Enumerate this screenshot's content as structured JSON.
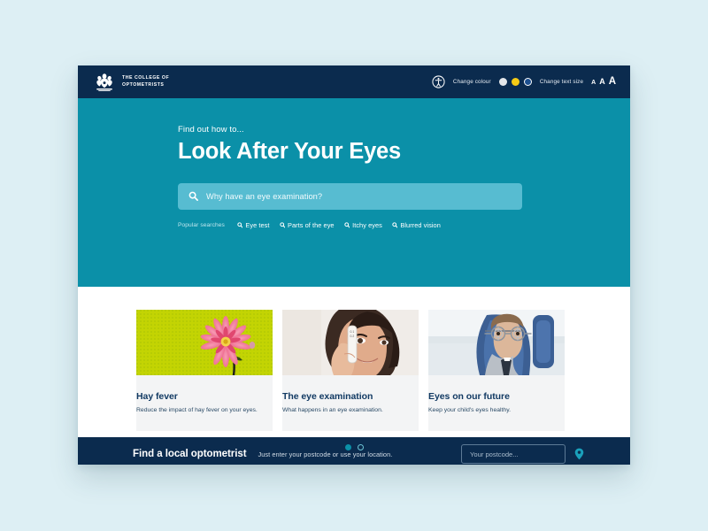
{
  "colors": {
    "page_bg": "#ddeff4",
    "navy": "#0b2b4e",
    "teal": "#0b90a8",
    "teal_light": "#57bcd1",
    "card_bg": "#f3f4f5",
    "heading": "#123a63",
    "swatch_white": "#e3e7ea",
    "swatch_yellow": "#f5cb15",
    "swatch_blue": "#1c4f8f"
  },
  "header": {
    "logo": {
      "icon": "crest-icon",
      "line1": "THE COLLEGE OF",
      "line2": "OPTOMETRISTS",
      "text": "THE COLLEGE OF\nOPTOMETRISTS"
    },
    "accessibility_icon": "accessibility-icon",
    "change_colour_label": "Change colour",
    "colour_swatches": [
      {
        "name": "swatch-white",
        "color": "#e3e7ea",
        "style": "filled"
      },
      {
        "name": "swatch-yellow",
        "color": "#f5cb15",
        "style": "filled"
      },
      {
        "name": "swatch-blue",
        "color": "#1c4f8f",
        "style": "ring"
      }
    ],
    "change_text_size_label": "Change text size",
    "text_sizes": [
      "A",
      "A",
      "A"
    ]
  },
  "hero": {
    "eyebrow": "Find out how to...",
    "title": "Look After Your Eyes",
    "search": {
      "icon": "search-icon",
      "placeholder": "Why have an eye examination?",
      "value": ""
    },
    "popular": {
      "label": "Popular searches",
      "items": [
        {
          "label": "Eye test",
          "icon": "search-icon"
        },
        {
          "label": "Parts of the eye",
          "icon": "search-icon"
        },
        {
          "label": "Itchy eyes",
          "icon": "search-icon"
        },
        {
          "label": "Blurred vision",
          "icon": "search-icon"
        }
      ]
    }
  },
  "cards": [
    {
      "title": "Hay fever",
      "description": "Reduce the impact of hay fever on your eyes.",
      "image": "pink-gerbera-flower-on-lime-green-background"
    },
    {
      "title": "The eye examination",
      "description": "What happens in an eye examination.",
      "image": "smiling-woman-holding-occluder-near-eye"
    },
    {
      "title": "Eyes on our future",
      "description": "Keep your child's eyes healthy.",
      "image": "child-wearing-trial-frame-glasses-in-exam-chair"
    }
  ],
  "carousel": {
    "dots": [
      {
        "state": "active"
      },
      {
        "state": "inactive"
      }
    ]
  },
  "footer": {
    "title": "Find a local optometrist",
    "subtitle": "Just enter your postcode or use your location.",
    "postcode": {
      "placeholder": "Your postcode...",
      "value": ""
    },
    "location_icon": "map-pin-icon"
  }
}
